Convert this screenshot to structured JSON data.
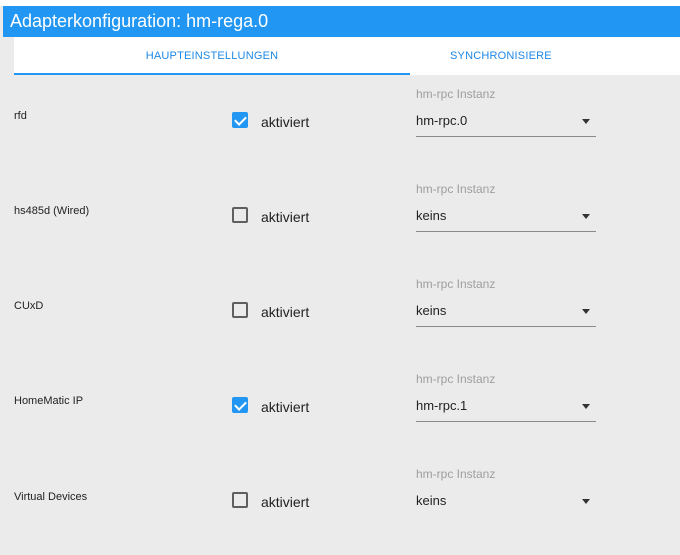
{
  "window": {
    "title": "Adapterkonfiguration: hm-rega.0"
  },
  "tabs": [
    {
      "label": "HAUPTEINSTELLUNGEN",
      "active": true
    },
    {
      "label": "SYNCHRONISIERE",
      "active": false
    }
  ],
  "rows": [
    {
      "label": "rfd",
      "checkbox_label": "aktiviert",
      "checked": true,
      "select_label": "hm-rpc Instanz",
      "select_value": "hm-rpc.0"
    },
    {
      "label": "hs485d (Wired)",
      "checkbox_label": "aktiviert",
      "checked": false,
      "select_label": "hm-rpc Instanz",
      "select_value": "keins"
    },
    {
      "label": "CUxD",
      "checkbox_label": "aktiviert",
      "checked": false,
      "select_label": "hm-rpc Instanz",
      "select_value": "keins"
    },
    {
      "label": "HomeMatic IP",
      "checkbox_label": "aktiviert",
      "checked": true,
      "select_label": "hm-rpc Instanz",
      "select_value": "hm-rpc.1"
    },
    {
      "label": "Virtual Devices",
      "checkbox_label": "aktiviert",
      "checked": false,
      "select_label": "hm-rpc Instanz",
      "select_value": "keins"
    }
  ],
  "colors": {
    "accent": "#2196f3",
    "background": "#ebebeb"
  },
  "icons": {
    "checkbox_checked": "check-icon",
    "dropdown": "caret-down-icon"
  }
}
